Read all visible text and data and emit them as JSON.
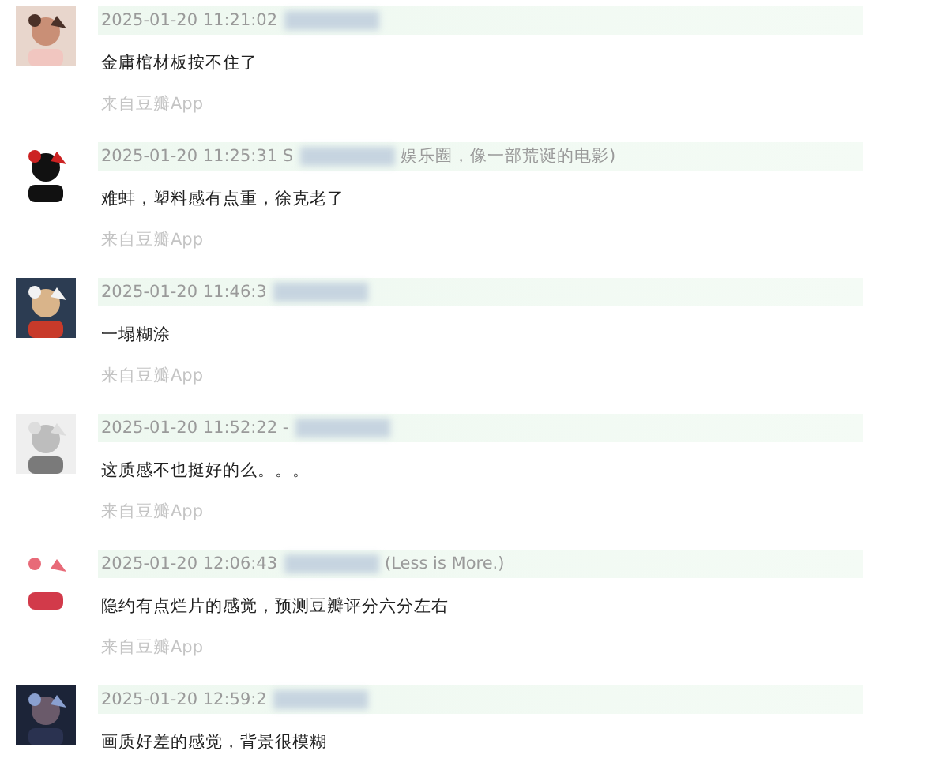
{
  "comments": [
    {
      "time": "2025-01-20 11:21:02 ",
      "text": "金庸棺材板按不住了",
      "source": "来自豆瓣App"
    },
    {
      "time": "2025-01-20 11:25:31 S",
      "name_tail": "娱乐圈，像一部荒诞的电影)",
      "text": "难蚌，塑料感有点重，徐克老了",
      "source": "来自豆瓣App"
    },
    {
      "time": "2025-01-20 11:46:3",
      "text": "一塌糊涂",
      "source": "来自豆瓣App"
    },
    {
      "time": "2025-01-20 11:52:22 -",
      "text": "这质感不也挺好的么。。。",
      "source": "来自豆瓣App"
    },
    {
      "time": "2025-01-20 12:06:43 ",
      "name_tail": "(Less is More.)",
      "text": "隐约有点烂片的感觉，预测豆瓣评分六分左右",
      "source": "来自豆瓣App"
    },
    {
      "time": "2025-01-20 12:59:2",
      "text": "画质好差的感觉，背景很模糊"
    }
  ]
}
